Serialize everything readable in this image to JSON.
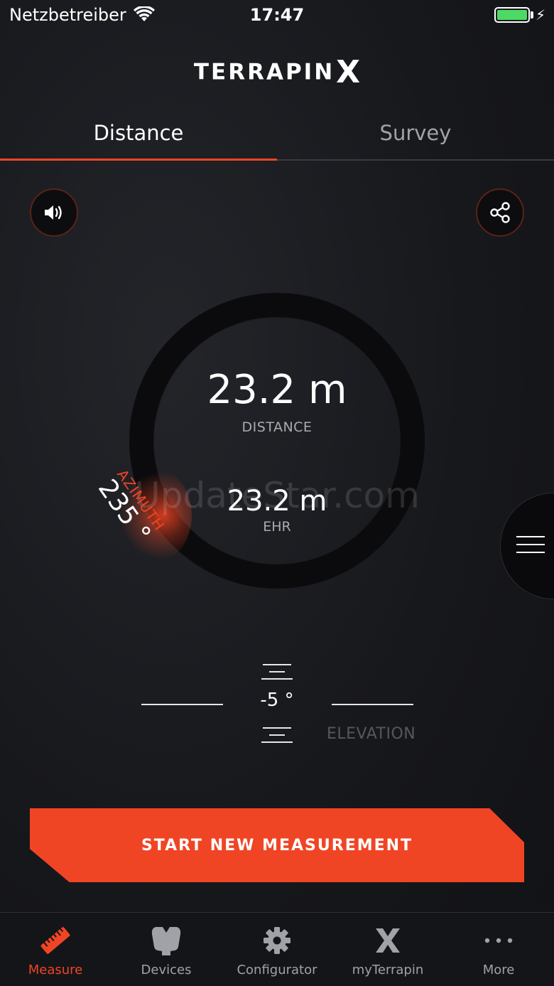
{
  "status_bar": {
    "carrier": "Netzbetreiber",
    "time": "17:47",
    "battery_icon": "battery-charging-icon",
    "wifi_icon": "wifi-icon"
  },
  "app": {
    "logo_word": "TERRAPIN",
    "logo_mark": "X"
  },
  "tabs": [
    {
      "label": "Distance",
      "active": true
    },
    {
      "label": "Survey",
      "active": false
    }
  ],
  "controls": {
    "sound_icon": "speaker-icon",
    "share_icon": "share-icon",
    "menu_icon": "menu-icon"
  },
  "measurement": {
    "distance_value": "23.2 m",
    "distance_label": "DISTANCE",
    "ehr_value": "23.2 m",
    "ehr_label": "EHR",
    "azimuth_label": "AZIMUTH",
    "azimuth_value": "235 °",
    "elevation_value": "-5 °",
    "elevation_label": "ELEVATION"
  },
  "watermark": "UpdateStar.com",
  "cta": {
    "label": "START NEW MEASUREMENT"
  },
  "bottom_nav": [
    {
      "label": "Measure",
      "icon": "ruler-icon",
      "active": true
    },
    {
      "label": "Devices",
      "icon": "device-icon",
      "active": false
    },
    {
      "label": "Configurator",
      "icon": "gear-icon",
      "active": false
    },
    {
      "label": "myTerrapin",
      "icon": "terrapin-x-icon",
      "active": false
    },
    {
      "label": "More",
      "icon": "more-icon",
      "active": false
    }
  ],
  "colors": {
    "accent": "#f04525",
    "background": "#141518",
    "battery": "#4cd964"
  }
}
